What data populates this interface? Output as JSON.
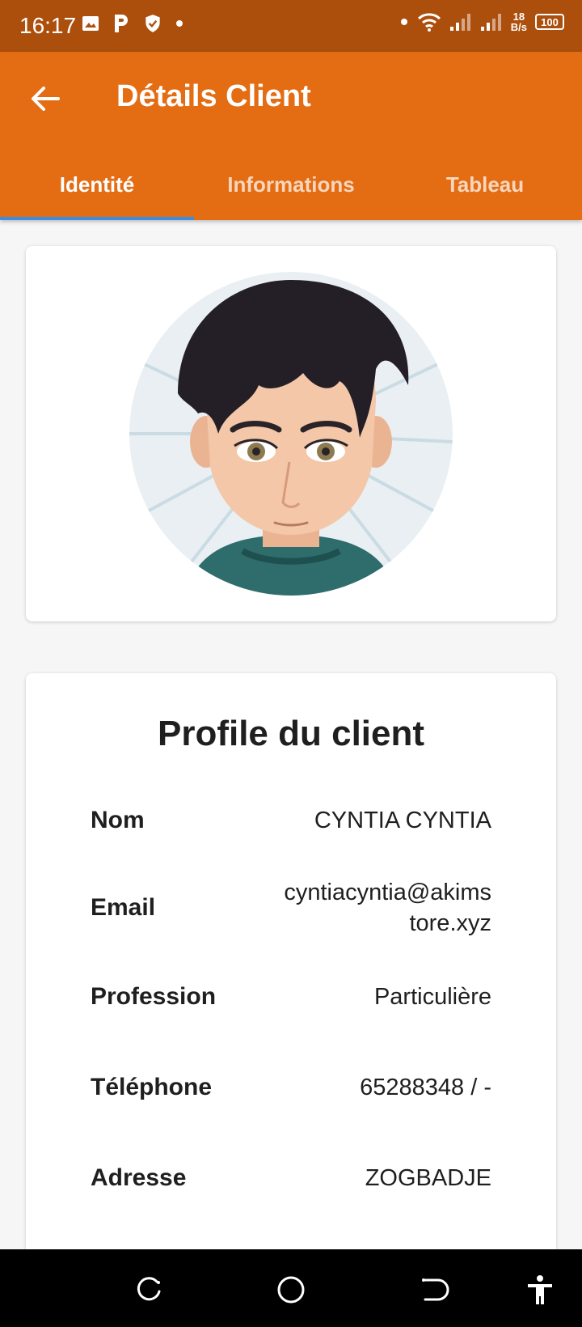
{
  "status_bar": {
    "time": "16:17",
    "speed_value": "18",
    "speed_unit": "B/s",
    "battery": "100"
  },
  "app_bar": {
    "title": "Détails Client",
    "tabs": [
      {
        "label": "Identité",
        "active": true
      },
      {
        "label": "Informations",
        "active": false
      },
      {
        "label": "Tableau",
        "active": false
      }
    ]
  },
  "profile": {
    "title": "Profile du client",
    "fields": [
      {
        "label": "Nom",
        "value": "CYNTIA CYNTIA"
      },
      {
        "label": "Email",
        "value": "cyntiacyntia@akimstore.xyz"
      },
      {
        "label": "Profession",
        "value": "Particulière"
      },
      {
        "label": "Téléphone",
        "value": "65288348 / -"
      },
      {
        "label": "Adresse",
        "value": "ZOGBADJE"
      }
    ]
  },
  "colors": {
    "status_bar": "#ac4f0d",
    "app_bar": "#e46c13",
    "tab_indicator": "#3d8be2"
  },
  "icons": {
    "back": "arrow-left-icon",
    "nav_recent": "recent-apps-icon",
    "nav_home": "home-icon",
    "nav_back": "back-icon",
    "accessibility": "accessibility-icon"
  }
}
